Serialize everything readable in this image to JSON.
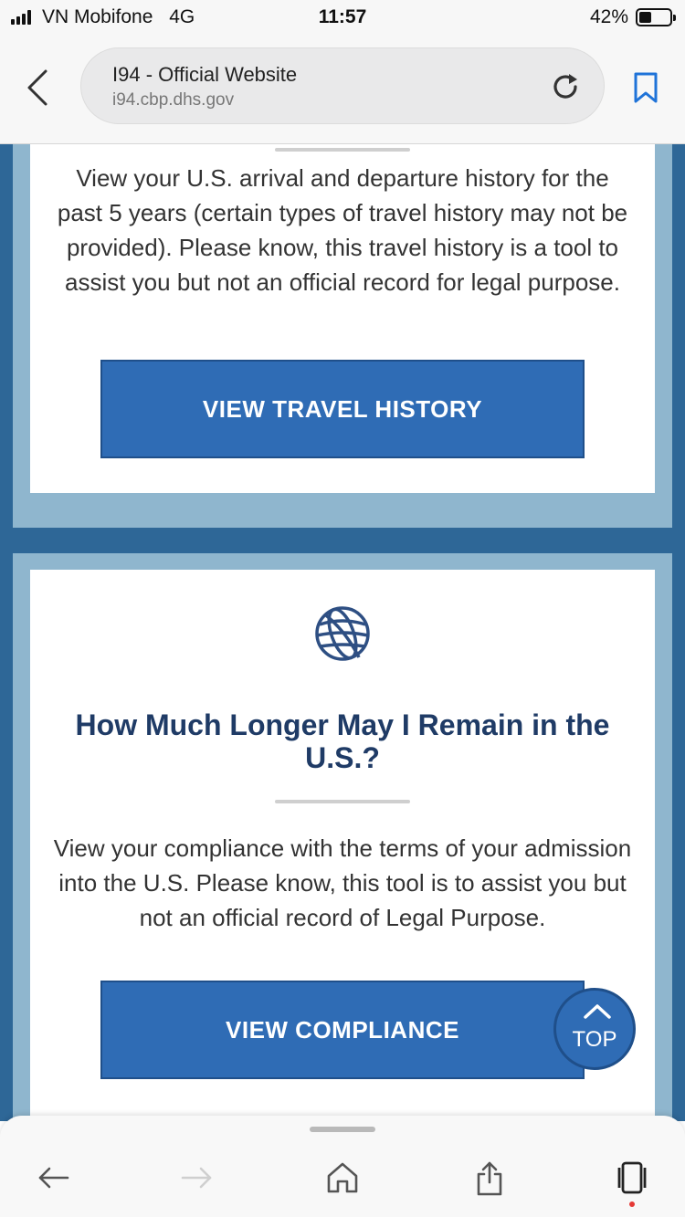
{
  "status_bar": {
    "carrier": "VN Mobifone",
    "network": "4G",
    "time": "11:57",
    "battery_percent": "42%",
    "battery_level": 0.42
  },
  "browser": {
    "page_title": "I94 - Official Website",
    "host": "i94.cbp.dhs.gov",
    "icons": {
      "back": "chevron-left-icon",
      "reload": "reload-icon",
      "bookmark": "bookmark-icon"
    }
  },
  "travel_history": {
    "description": "View your U.S. arrival and departure history for the past 5 years (certain types of travel history may not be provided). Please know, this travel history is a tool to assist you but not an official record for legal purpose.",
    "button_label": "VIEW TRAVEL HISTORY"
  },
  "compliance": {
    "icon": "globe-icon",
    "title": "How Much Longer May I Remain in the U.S.?",
    "description": "View your compliance with the terms of your admission into the U.S. Please know, this tool is to assist you but not an official record of Legal Purpose.",
    "button_label": "VIEW COMPLIANCE"
  },
  "scroll_top": {
    "label": "TOP"
  },
  "toolbar": {
    "icons": [
      "back-arrow-icon",
      "forward-arrow-icon",
      "home-icon",
      "share-icon",
      "tabs-icon"
    ]
  },
  "colors": {
    "page_background": "#2e6797",
    "frame": "#8fb6ce",
    "button": "#2f6cb5",
    "heading": "#1f3b66"
  }
}
